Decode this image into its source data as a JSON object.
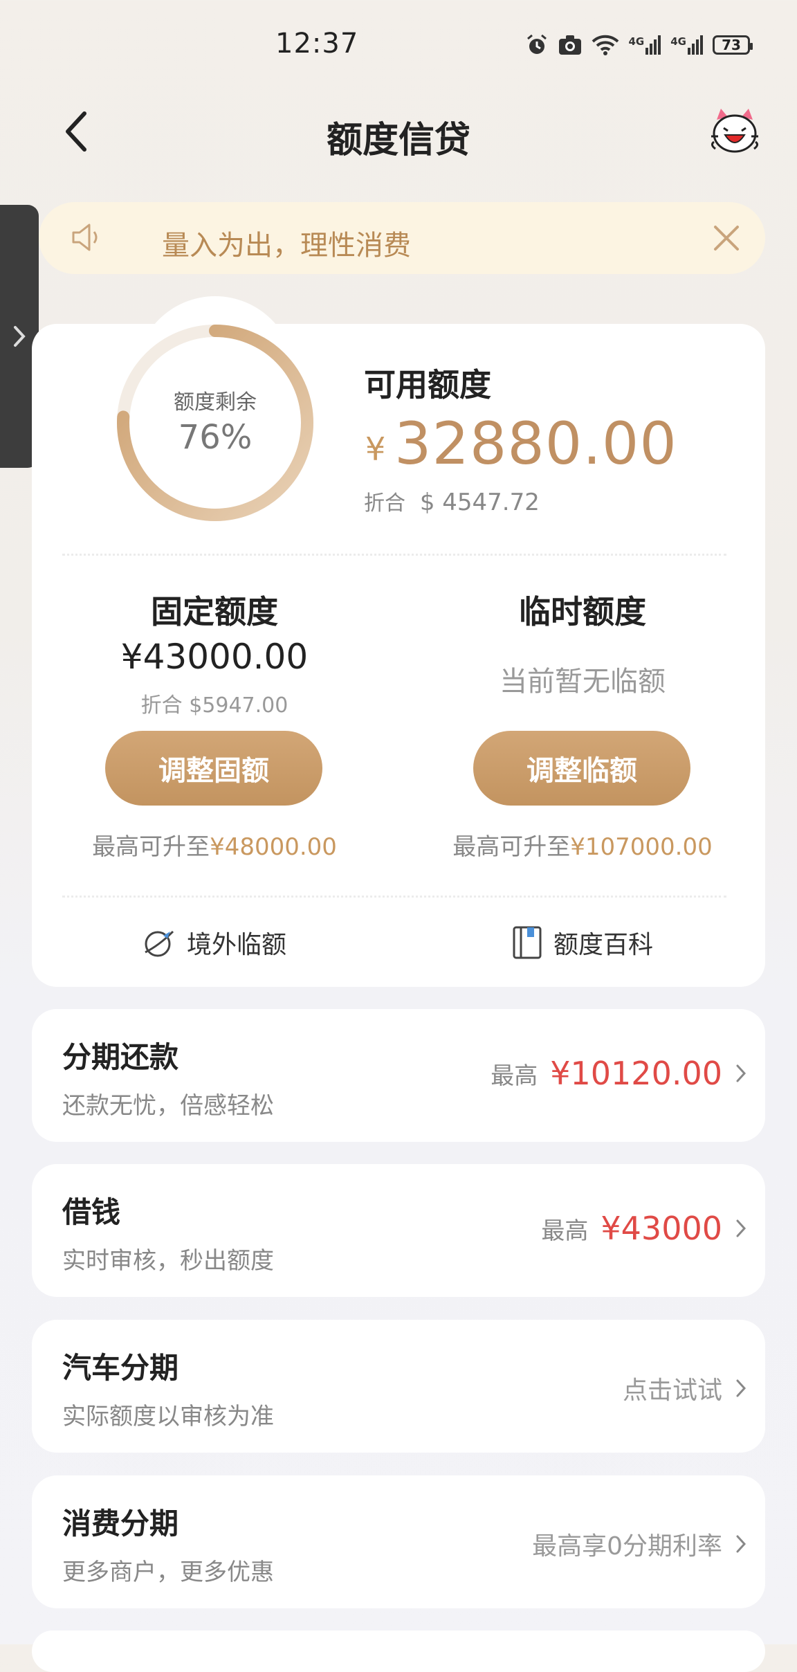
{
  "status": {
    "time": "12:37",
    "battery": "73",
    "net1": "4G",
    "net2": "4G"
  },
  "header": {
    "title": "额度信贷"
  },
  "notice": {
    "text": "量入为出，理性消费"
  },
  "credit": {
    "ring_label": "额度剩余",
    "ring_percent": "76%",
    "ring_fraction": 0.76,
    "available_label": "可用额度",
    "currency": "¥",
    "available_amount": "32880.00",
    "converted_prefix": "折合",
    "converted_value": "$ 4547.72",
    "fixed": {
      "title": "固定额度",
      "amount": "¥43000.00",
      "converted": "折合 $5947.00",
      "button": "调整固额",
      "max_prefix": "最高可升至",
      "max_value": "¥48000.00"
    },
    "temporary": {
      "title": "临时额度",
      "status": "当前暂无临额",
      "button": "调整临额",
      "max_prefix": "最高可升至",
      "max_value": "¥107000.00"
    },
    "links": [
      {
        "label": "境外临额",
        "icon": "globe-plane-icon"
      },
      {
        "label": "额度百科",
        "icon": "book-icon"
      }
    ]
  },
  "products": [
    {
      "title": "分期还款",
      "subtitle": "还款无忧，倍感轻松",
      "prefix": "最高",
      "value": "¥10120.00",
      "hint": ""
    },
    {
      "title": "借钱",
      "subtitle": "实时审核，秒出额度",
      "prefix": "最高",
      "value": "¥43000",
      "hint": ""
    },
    {
      "title": "汽车分期",
      "subtitle": "实际额度以审核为准",
      "prefix": "",
      "value": "",
      "hint": "点击试试"
    },
    {
      "title": "消费分期",
      "subtitle": "更多商户，更多优惠",
      "prefix": "",
      "value": "",
      "hint": "最高享0分期利率"
    }
  ],
  "colors": {
    "gold": "#c09063",
    "accent_red": "#e04a46",
    "notice_bg": "#fcf4e2"
  }
}
